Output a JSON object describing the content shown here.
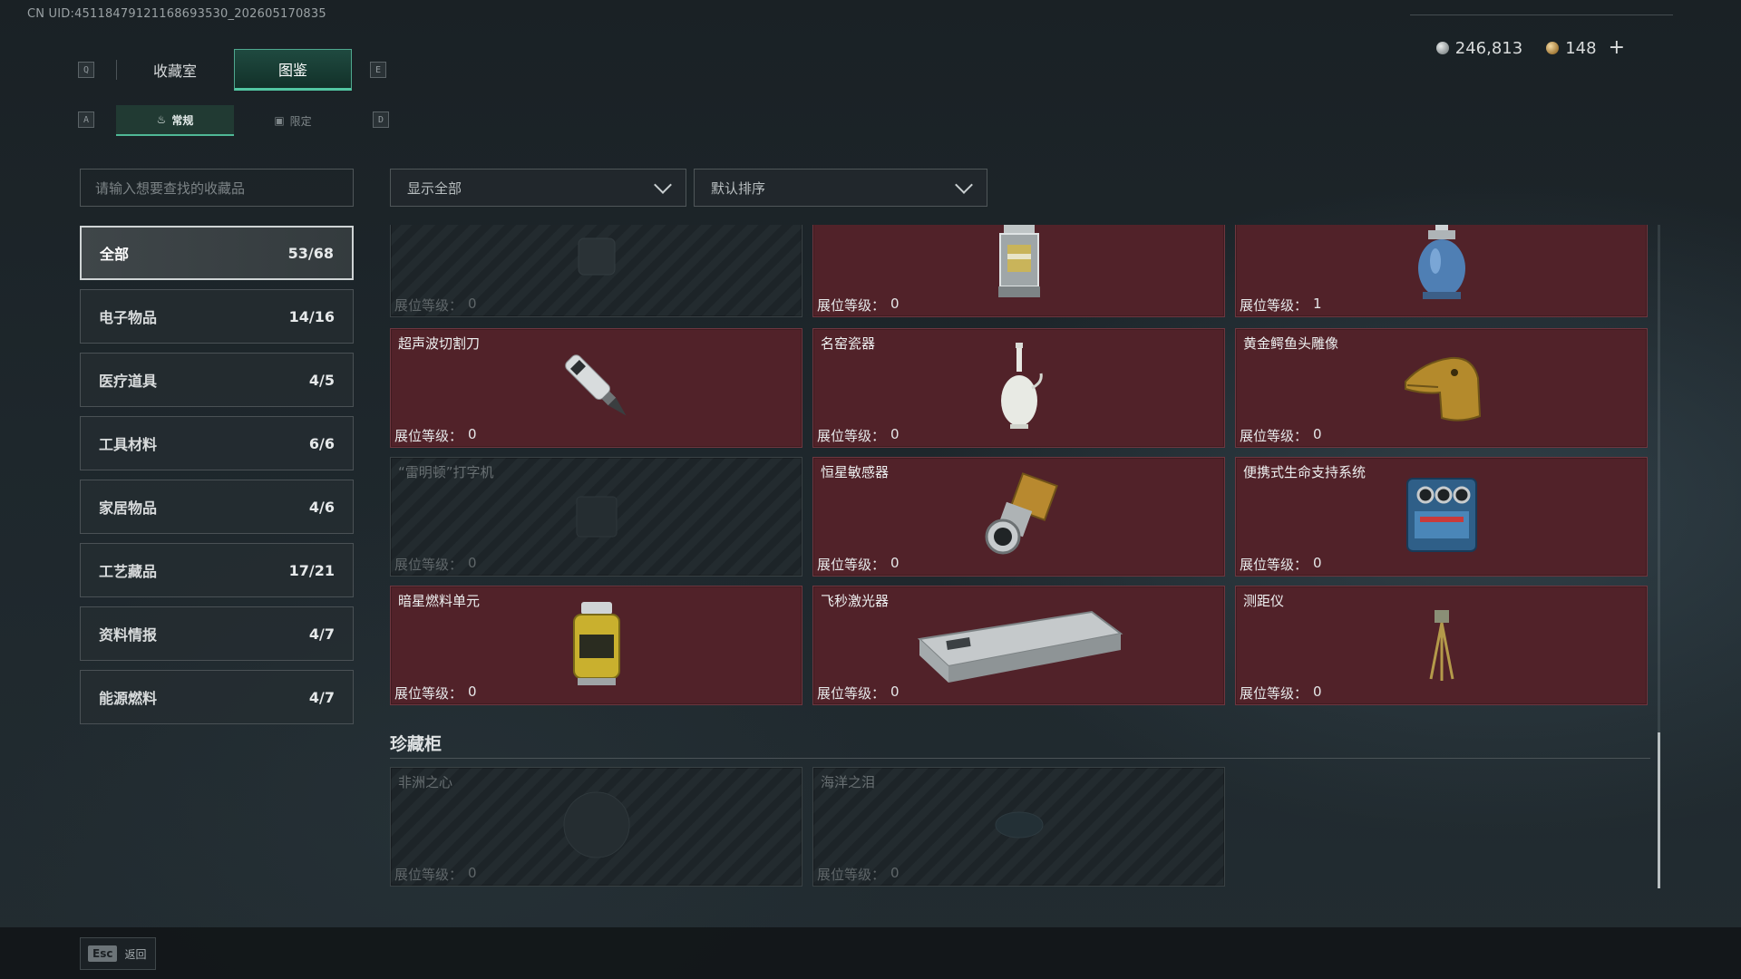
{
  "uid": "CN UID:4511847912116869353​0_202605170835",
  "currency": {
    "silver": "246,813",
    "gold": "148",
    "add_symbol": "+"
  },
  "keys": {
    "prev_tab": "Q",
    "next_tab": "E",
    "prev_sub": "A",
    "next_sub": "D"
  },
  "tabs": [
    {
      "label": "收藏室",
      "active": false
    },
    {
      "label": "图鉴",
      "active": true
    }
  ],
  "subtabs": [
    {
      "label": "常规",
      "active": true
    },
    {
      "label": "限定",
      "active": false
    }
  ],
  "search": {
    "placeholder": "请输入想要查找的收藏品"
  },
  "categories": [
    {
      "label": "全部",
      "count": "53/68"
    },
    {
      "label": "电子物品",
      "count": "14/16"
    },
    {
      "label": "医疗道具",
      "count": "4/5"
    },
    {
      "label": "工具材料",
      "count": "6/6"
    },
    {
      "label": "家居物品",
      "count": "4/6"
    },
    {
      "label": "工艺藏品",
      "count": "17/21"
    },
    {
      "label": "资料情报",
      "count": "4/7"
    },
    {
      "label": "能源燃料",
      "count": "4/7"
    }
  ],
  "filters": {
    "show": "显示全部",
    "sort": "默认排序"
  },
  "level_label": "展位等级：",
  "cards": [
    {
      "name": "",
      "level": "0",
      "owned": false,
      "icon": "unknown-item"
    },
    {
      "name": "",
      "level": "0",
      "owned": true,
      "icon": "lantern"
    },
    {
      "name": "",
      "level": "1",
      "owned": true,
      "icon": "gas-canister"
    },
    {
      "name": "超声波切割刀",
      "level": "0",
      "owned": true,
      "icon": "ultrasonic-cutter"
    },
    {
      "name": "名窑瓷器",
      "level": "0",
      "owned": true,
      "icon": "porcelain-vase"
    },
    {
      "name": "黄金鳄鱼头雕像",
      "level": "0",
      "owned": true,
      "icon": "golden-crocodile-head"
    },
    {
      "name": "“雷明顿”打字机",
      "level": "0",
      "owned": false,
      "icon": "typewriter"
    },
    {
      "name": "恒星敏感器",
      "level": "0",
      "owned": true,
      "icon": "star-sensor"
    },
    {
      "name": "便携式生命支持系统",
      "level": "0",
      "owned": true,
      "icon": "life-support-system"
    },
    {
      "name": "暗星燃料单元",
      "level": "0",
      "owned": true,
      "icon": "fuel-cell"
    },
    {
      "name": "飞秒激光器",
      "level": "0",
      "owned": true,
      "icon": "femtosecond-laser"
    },
    {
      "name": "测距仪",
      "level": "0",
      "owned": true,
      "icon": "rangefinder"
    }
  ],
  "vault": {
    "title": "珍藏柜",
    "cards": [
      {
        "name": "非洲之心",
        "level": "0",
        "owned": false,
        "icon": "heart-of-africa"
      },
      {
        "name": "海洋之泪",
        "level": "0",
        "owned": false,
        "icon": "tear-of-ocean"
      }
    ]
  },
  "footer": {
    "esc_key": "Esc",
    "back_label": "返回"
  }
}
